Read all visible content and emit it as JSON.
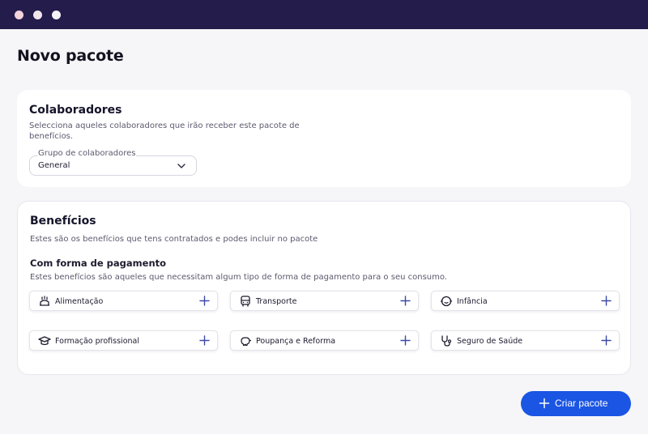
{
  "window": {
    "dots": [
      "#f3d3dc",
      "#f1e6ee",
      "#f6f3f8"
    ]
  },
  "page": {
    "title": "Novo pacote"
  },
  "collaborators": {
    "title": "Colaboradores",
    "description_line1": "Selecciona aqueles colaboradores que irão receber este pacote de",
    "description_line2": "benefícios.",
    "group_select": {
      "label": "Grupo de colaboradores",
      "value": "General",
      "icon": "chevron-down-icon"
    }
  },
  "benefits": {
    "title": "Benefícios",
    "description": "Estes são os benefícios que tens contratados e podes incluir no pacote",
    "payment_section": {
      "title": "Com forma de pagamento",
      "description": "Estes benefícios são aqueles que necessitam algum tipo de forma de pagamento para o seu consumo.",
      "items": [
        {
          "label": "Alimentação",
          "icon": "food-icon"
        },
        {
          "label": "Transporte",
          "icon": "bus-icon"
        },
        {
          "label": "Infância",
          "icon": "baby-icon"
        },
        {
          "label": "Formação profissional",
          "icon": "graduation-cap-icon"
        },
        {
          "label": "Poupança e Reforma",
          "icon": "piggy-bank-icon"
        },
        {
          "label": "Seguro de Saúde",
          "icon": "stethoscope-icon"
        }
      ]
    }
  },
  "actions": {
    "create_label": "Criar pacote",
    "create_icon": "plus-icon"
  },
  "colors": {
    "titlebar": "#241c4a",
    "accent": "#1a55e3",
    "plus_icon": "#3b4aa8"
  }
}
